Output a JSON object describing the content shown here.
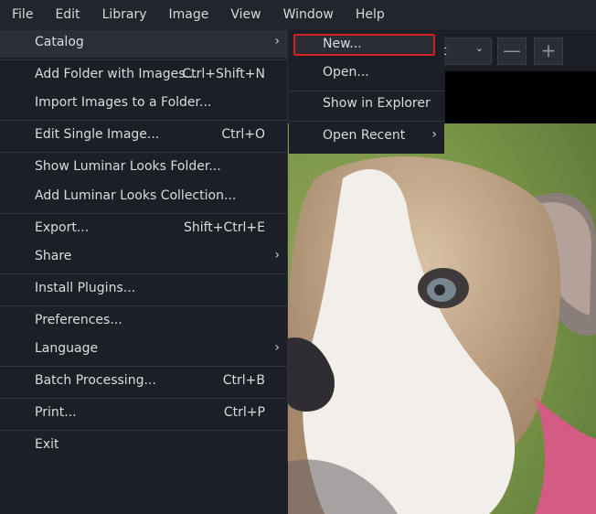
{
  "menubar": {
    "items": [
      {
        "label": "File"
      },
      {
        "label": "Edit"
      },
      {
        "label": "Library"
      },
      {
        "label": "Image"
      },
      {
        "label": "View"
      },
      {
        "label": "Window"
      },
      {
        "label": "Help"
      }
    ]
  },
  "toolbar": {
    "select_value": "t",
    "minus_label": "—",
    "plus_label": "+"
  },
  "file_menu": {
    "items": [
      {
        "label": "Catalog",
        "shortcut": "",
        "submenu": true
      },
      {
        "label": "Add Folder with Images...",
        "shortcut": "Ctrl+Shift+N"
      },
      {
        "label": "Import Images to a Folder...",
        "shortcut": ""
      },
      {
        "label": "Edit Single Image...",
        "shortcut": "Ctrl+O"
      },
      {
        "label": "Show Luminar Looks Folder...",
        "shortcut": ""
      },
      {
        "label": "Add Luminar Looks Collection...",
        "shortcut": ""
      },
      {
        "label": "Export...",
        "shortcut": "Shift+Ctrl+E"
      },
      {
        "label": "Share",
        "shortcut": "",
        "submenu": true
      },
      {
        "label": "Install Plugins...",
        "shortcut": ""
      },
      {
        "label": "Preferences...",
        "shortcut": ""
      },
      {
        "label": "Language",
        "shortcut": "",
        "submenu": true
      },
      {
        "label": "Batch Processing...",
        "shortcut": "Ctrl+B"
      },
      {
        "label": "Print...",
        "shortcut": "Ctrl+P"
      },
      {
        "label": "Exit",
        "shortcut": ""
      }
    ],
    "submenu_arrow": "›"
  },
  "catalog_submenu": {
    "items": [
      {
        "label": "New..."
      },
      {
        "label": "Open..."
      },
      {
        "label": "Show in Explorer"
      },
      {
        "label": "Open Recent",
        "submenu": true
      }
    ]
  },
  "colors": {
    "menu_bg": "#1c1f25",
    "highlight_border": "#d02222",
    "active_bg": "#2b2f37"
  }
}
